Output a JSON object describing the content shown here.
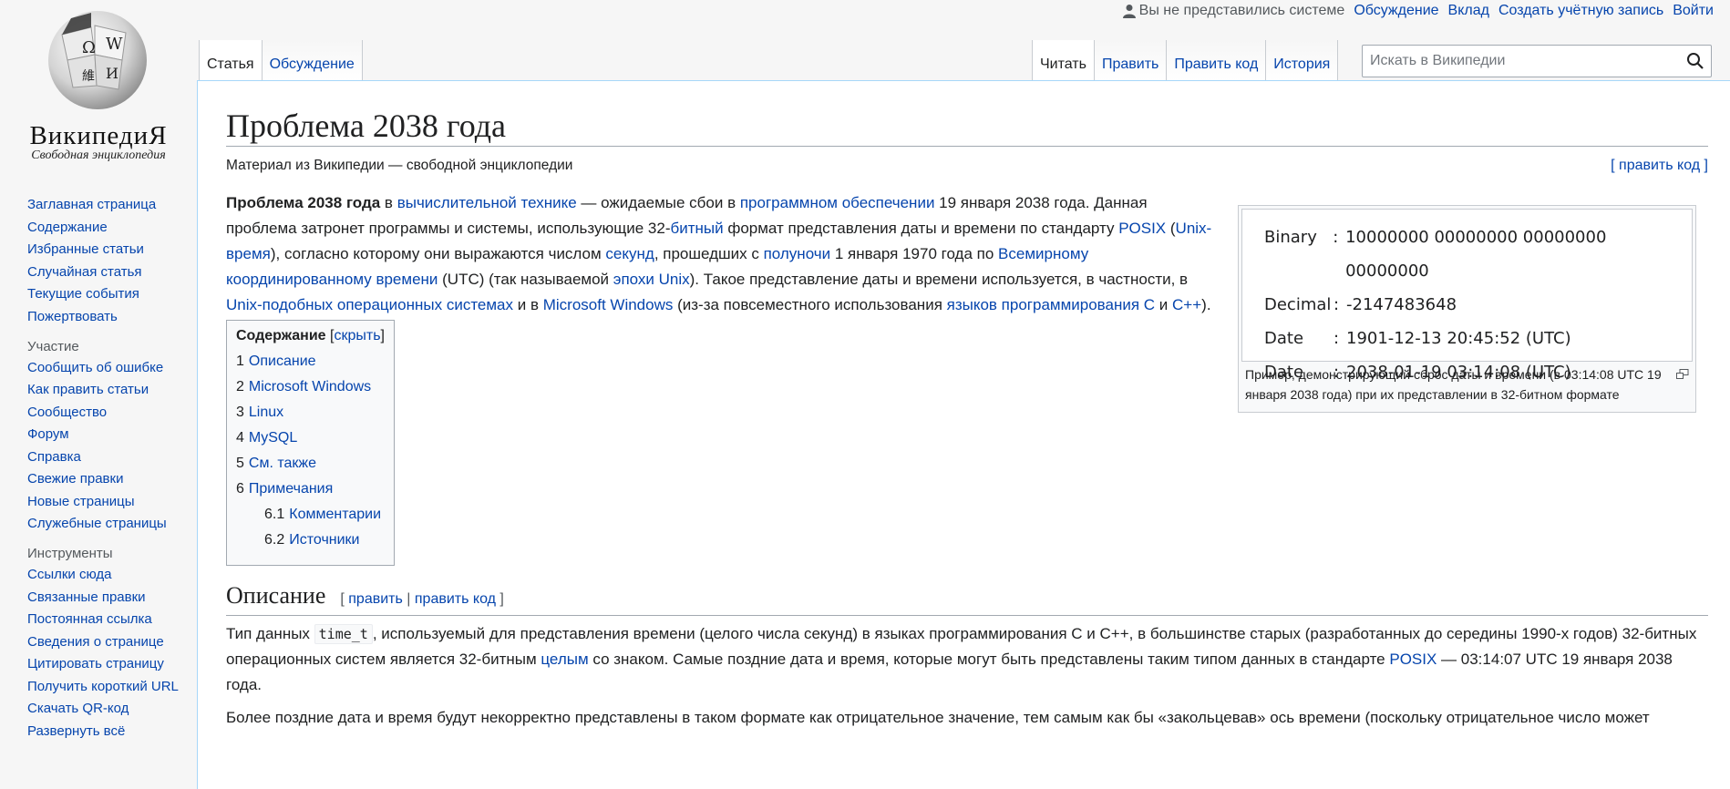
{
  "logo": {
    "wordmark": "ВикипедиЯ",
    "tagline": "Свободная энциклопедия"
  },
  "personal": {
    "anon": "Вы не представились системе",
    "links": [
      "Обсуждение",
      "Вклад",
      "Создать учётную запись",
      "Войти"
    ]
  },
  "nav": {
    "main": [
      "Заглавная страница",
      "Содержание",
      "Избранные статьи",
      "Случайная статья",
      "Текущие события",
      "Пожертвовать"
    ],
    "participation_title": "Участие",
    "participation": [
      "Сообщить об ошибке",
      "Как править статьи",
      "Сообщество",
      "Форум",
      "Справка",
      "Свежие правки",
      "Новые страницы",
      "Служебные страницы"
    ],
    "tools_title": "Инструменты",
    "tools": [
      "Ссылки сюда",
      "Связанные правки",
      "Постоянная ссылка",
      "Сведения о странице",
      "Цитировать страницу",
      "Получить короткий URL",
      "Скачать QR-код",
      "Развернуть всё"
    ]
  },
  "tabs": {
    "left": [
      "Статья",
      "Обсуждение"
    ],
    "right": [
      "Читать",
      "Править",
      "Править код",
      "История"
    ]
  },
  "search": {
    "placeholder": "Искать в Википедии"
  },
  "article": {
    "title": "Проблема 2038 года",
    "from": "Материал из Википедии — свободной энциклопедии",
    "edit_code": "[ править код ]",
    "intro": [
      {
        "t": "Проблема 2038 года",
        "b": true
      },
      {
        "t": " в "
      },
      {
        "t": "вычислительной технике",
        "l": true
      },
      {
        "t": " — ожидаемые сбои в "
      },
      {
        "t": "программном обеспечении",
        "l": true
      },
      {
        "t": " 19 января 2038 года. Данная проблема затронет программы и системы, использующие 32-"
      },
      {
        "t": "битный",
        "l": true
      },
      {
        "t": " формат представления даты и времени по стандарту "
      },
      {
        "t": "POSIX",
        "l": true
      },
      {
        "t": " ("
      },
      {
        "t": "Unix-время",
        "l": true
      },
      {
        "t": "), согласно которому они выражаются числом "
      },
      {
        "t": "секунд",
        "l": true
      },
      {
        "t": ", прошедших с "
      },
      {
        "t": "полуночи",
        "l": true
      },
      {
        "t": " 1 января 1970 года по "
      },
      {
        "t": "Всемирному координированному времени",
        "l": true
      },
      {
        "t": " (UTC) (так называемой "
      },
      {
        "t": "эпохи Unix",
        "l": true
      },
      {
        "t": "). Такое представление даты и времени используется, в частности, в "
      },
      {
        "t": "Unix-подобных операционных системах",
        "l": true
      },
      {
        "t": " и в "
      },
      {
        "t": "Microsoft Windows",
        "l": true
      },
      {
        "t": " (из-за повсеместного использования "
      },
      {
        "t": "языков программирования C",
        "l": true
      },
      {
        "t": " и "
      },
      {
        "t": "C++",
        "l": true
      },
      {
        "t": ")."
      }
    ],
    "thumb": {
      "rows": [
        {
          "k": "Binary",
          "v": "10000000 00000000 00000000 00000000"
        },
        {
          "k": "Decimal",
          "v": "-2147483648"
        },
        {
          "k": "Date",
          "v": "1901-12-13 20:45:52 (UTC)"
        },
        {
          "k": "Date",
          "v": "2038-01-19 03:14:08 (UTC)"
        }
      ],
      "caption": "Пример, демонстрирующий сброс даты и времени (в 03:14:08 UTC 19 января 2038 года) при их представлении в 32-битном формате"
    },
    "toc": {
      "title": "Содержание",
      "hide": "скрыть",
      "items": [
        {
          "n": "1",
          "t": "Описание",
          "sub": false
        },
        {
          "n": "2",
          "t": "Microsoft Windows",
          "sub": false
        },
        {
          "n": "3",
          "t": "Linux",
          "sub": false
        },
        {
          "n": "4",
          "t": "MySQL",
          "sub": false
        },
        {
          "n": "5",
          "t": "См. также",
          "sub": false
        },
        {
          "n": "6",
          "t": "Примечания",
          "sub": false
        },
        {
          "n": "6.1",
          "t": "Комментарии",
          "sub": true
        },
        {
          "n": "6.2",
          "t": "Источники",
          "sub": true
        }
      ]
    },
    "section1": {
      "title": "Описание",
      "edit": "править",
      "edit_code": "править код",
      "p1": [
        {
          "t": "Тип данных "
        },
        {
          "t": "time_t",
          "c": true
        },
        {
          "t": ", используемый для представления времени (целого числа секунд) в языках программирования C и C++, в большинстве старых (разработанных до середины 1990-х годов) 32-битных операционных систем является 32-битным "
        },
        {
          "t": "целым",
          "l": true
        },
        {
          "t": " со знаком. Самые поздние дата и время, которые могут быть представлены таким типом данных в стандарте "
        },
        {
          "t": "POSIX",
          "l": true
        },
        {
          "t": " — 03:14:07 UTC 19 января 2038 года."
        }
      ],
      "p2": "Более поздние дата и время будут некорректно представлены в таком формате как отрицательное значение, тем самым как бы «закольцевав» ось времени (поскольку отрицательное число может"
    }
  }
}
